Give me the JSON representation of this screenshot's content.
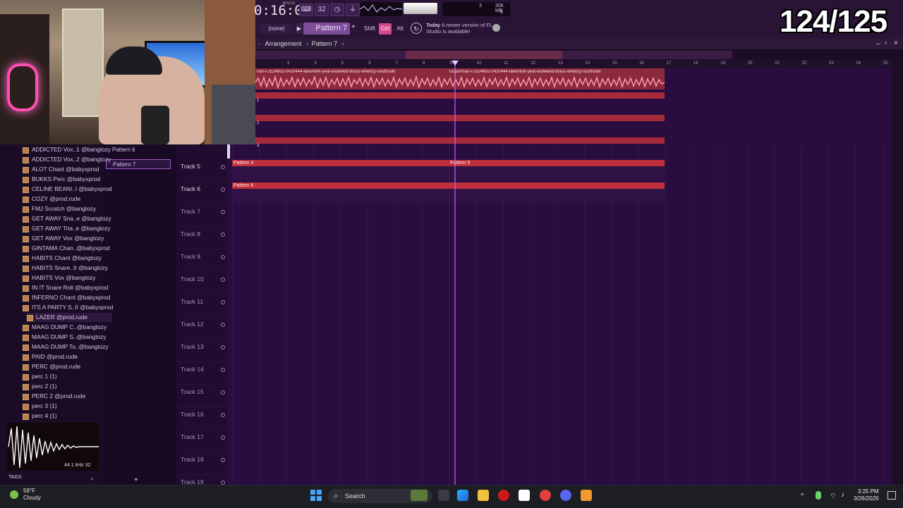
{
  "toolbar": {
    "time": "0:16:09",
    "time_unit": "M:S:CS",
    "none_select": "(none)",
    "pattern_select": "Pattern 7",
    "shift": "Shift",
    "ctrl": "Ctrl",
    "alt": "Alt",
    "cpu_readout": "3",
    "memory": "306 MB",
    "memory_sub": "6",
    "news_when": "Today",
    "news_text": "A newer version of FL Studio is available!"
  },
  "counter": "124/125",
  "breadcrumb": {
    "arrangement": "Arrangement",
    "pattern": "Pattern 7"
  },
  "ruler": [
    "3",
    "4",
    "5",
    "6",
    "7",
    "8",
    "9",
    "10",
    "11",
    "12",
    "13",
    "14",
    "15",
    "16",
    "17",
    "18",
    "19",
    "20",
    "21",
    "22",
    "23",
    "24",
    "25"
  ],
  "clips": {
    "audio_left": "nan-I-2524602-0420444-fakemink-yeat-esdeekid-brass-wheezy-southside",
    "audio_right": "looperman-I-2524602-0420444-fakemink-yeat-esdeekid-brass-wheezy-southside",
    "lane1": "1",
    "lane2": "2",
    "lane3": "3",
    "pattern4": "Pattern 4",
    "pattern5": "Pattern 5",
    "pattern6": "Pattern 6"
  },
  "tracks": [
    "Track 5",
    "Track 6",
    "Track 7",
    "Track 8",
    "Track 9",
    "Track 10",
    "Track 11",
    "Track 12",
    "Track 13",
    "Track 14",
    "Track 15",
    "Track 16",
    "Track 17",
    "Track 18",
    "Track 19"
  ],
  "picker": [
    "Pattern 6",
    "Pattern 7"
  ],
  "browser": [
    "ADDICTED Vox..1 @bangtozy",
    "ADDICTED Vox..2 @bangtozy",
    "ALOT Chant @babyxprod",
    "BUKKS Perc @babyxprod",
    "CELINE BEANI..I @babyxprod",
    "COZY @prod.rude",
    "FMJ Scratch @bangtozy",
    "GET AWAY Sna..e @bangtozy",
    "GET AWAY Tria..e @bangtozy",
    "GET AWAY Vox @bangtozy",
    "GINTAMA Chan..@babyxprod",
    "HABITS Chant @bangtozy",
    "HABITS Snare..II @bangtozy",
    "HABITS Vox @bangtozy",
    "IN IT Snare Roll @babyxprod",
    "INFERNO Chant @babyxprod",
    "ITS A PARTY S..II @babyxprod",
    "LAZER @prod.rude",
    "MAAG DUMP C..@bangtozy",
    "MAAG DUMP S..@bangtozy",
    "MAAG DUMP To..@bangtozy",
    "PAID @prod.rude",
    "PERC @prod.rude",
    "perc 1 (1)",
    "perc 2 (1)",
    "PERC 2 @prod.rude",
    "perc 3 (1)",
    "perc 4 (1)"
  ],
  "browser_footer": {
    "khz": "44.1 kHz 32",
    "tags": "TAGS"
  },
  "taskbar": {
    "temp": "58°F",
    "condition": "Cloudy",
    "search": "Search",
    "time": "3:25 PM",
    "date": "3/26/2026"
  }
}
